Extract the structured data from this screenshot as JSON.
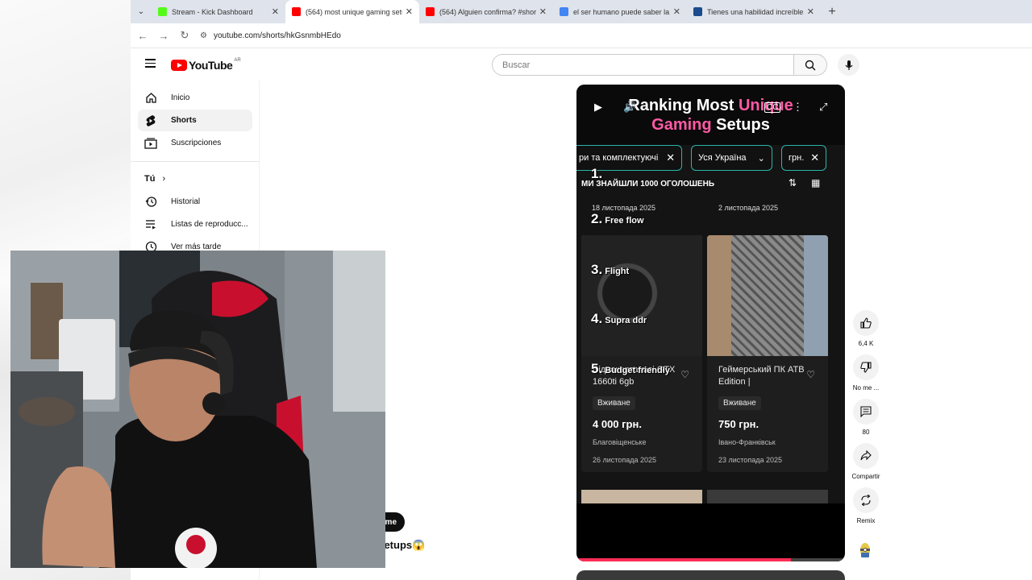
{
  "browser": {
    "tabs": [
      {
        "title": "Stream - Kick Dashboard",
        "favicon": "kick-icon",
        "color": "#53fc18",
        "active": false
      },
      {
        "title": "(564) most unique gaming setu",
        "favicon": "youtube-icon",
        "color": "#ff0000",
        "active": true
      },
      {
        "title": "(564) Alguien confirma? #short",
        "favicon": "youtube-icon",
        "color": "#ff0000",
        "active": false
      },
      {
        "title": "el ser humano puede saber la t",
        "favicon": "google-icon",
        "color": "#4285f4",
        "active": false
      },
      {
        "title": "Tienes una habilidad increíble c",
        "favicon": "c-icon",
        "color": "#1a4b8c",
        "active": false
      }
    ],
    "url": "youtube.com/shorts/hkGsnmbHEdo"
  },
  "youtube": {
    "logo_text": "YouTube",
    "country": "AR",
    "search_placeholder": "Buscar",
    "sidebar": {
      "items": [
        {
          "label": "Inicio",
          "icon": "home-icon"
        },
        {
          "label": "Shorts",
          "icon": "shorts-icon"
        },
        {
          "label": "Suscripciones",
          "icon": "subscriptions-icon"
        }
      ],
      "you_heading": "Tú",
      "you_items": [
        {
          "label": "Historial",
          "icon": "history-icon"
        },
        {
          "label": "Listas de reproducc...",
          "icon": "playlists-icon"
        },
        {
          "label": "Ver más tarde",
          "icon": "watch-later-icon"
        }
      ]
    },
    "short": {
      "overlay_title_1": "Ranking Most ",
      "overlay_title_1_pink": "Unique",
      "overlay_title_2_pink": "Gaming",
      "overlay_title_2": " Setups",
      "filter_chips": [
        "ри та комплектуючі",
        "Уся Україна",
        "грн."
      ],
      "found_text": "МИ ЗНАЙШЛИ 1000 ОГОЛОШЕНЬ",
      "top_dates": [
        "18 листопада 2025",
        "2 листопада 2025"
      ],
      "ranks": [
        {
          "num": "1.",
          "label": ""
        },
        {
          "num": "2.",
          "label": "Free flow"
        },
        {
          "num": "3.",
          "label": "Flight"
        },
        {
          "num": "4.",
          "label": "Supra ddr"
        },
        {
          "num": "5.",
          "label": "Budget friendly"
        }
      ],
      "cards": [
        {
          "name": "Відеокарта msi GTX 1660ti 6gb",
          "condition": "Вживане",
          "price": "4 000 грн.",
          "city": "Благовіщенське",
          "date": "26 листопада 2025"
        },
        {
          "name": "Геймерський ПК ATB Edition  |",
          "condition": "Вживане",
          "price": "750 грн.",
          "city": "Івано-Франківськ",
          "date": "23 листопада 2025"
        }
      ],
      "progress": 0.8
    },
    "actions": [
      {
        "label": "6,4 K",
        "icon": "like-icon"
      },
      {
        "label": "No me ...",
        "icon": "dislike-icon"
      },
      {
        "label": "80",
        "icon": "comment-icon"
      },
      {
        "label": "Compartir",
        "icon": "share-icon"
      },
      {
        "label": "Remix",
        "icon": "remix-icon"
      }
    ],
    "behind_overlay": {
      "pill_text": "me",
      "title_fragment": "j setups😱"
    }
  }
}
